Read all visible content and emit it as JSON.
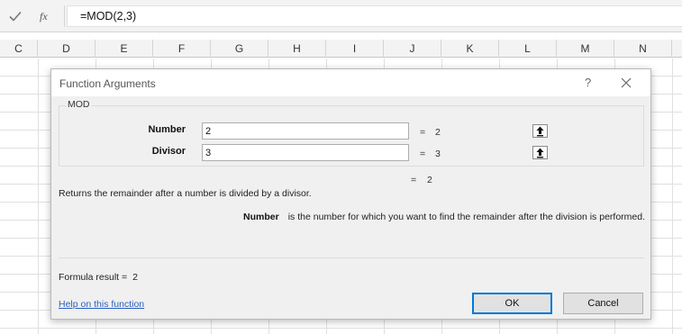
{
  "formula_bar": {
    "confirm_icon": "checkmark-icon",
    "fx_label": "fx",
    "formula": "=MOD(2,3)"
  },
  "columns": [
    "C",
    "D",
    "E",
    "F",
    "G",
    "H",
    "I",
    "J",
    "K",
    "L",
    "M",
    "N"
  ],
  "dialog": {
    "title": "Function Arguments",
    "help_label": "?",
    "close_icon": "close-icon",
    "function_name": "MOD",
    "arguments": [
      {
        "label": "Number",
        "value": "2",
        "equals": "=",
        "result": "2"
      },
      {
        "label": "Divisor",
        "value": "3",
        "equals": "=",
        "result": "3"
      }
    ],
    "overall_equals": "=",
    "overall_result": "2",
    "description": "Returns the remainder after a number is divided by a divisor.",
    "arg_detail_name": "Number",
    "arg_detail_text": "is the number for which you want to find the remainder after the division is performed.",
    "formula_result_label": "Formula result =",
    "formula_result_value": "2",
    "help_link": "Help on this function",
    "ok_label": "OK",
    "cancel_label": "Cancel",
    "colors": {
      "accent": "#0078d7",
      "link": "#2a5fbf",
      "dialog_bg": "#f0f0f0"
    }
  }
}
